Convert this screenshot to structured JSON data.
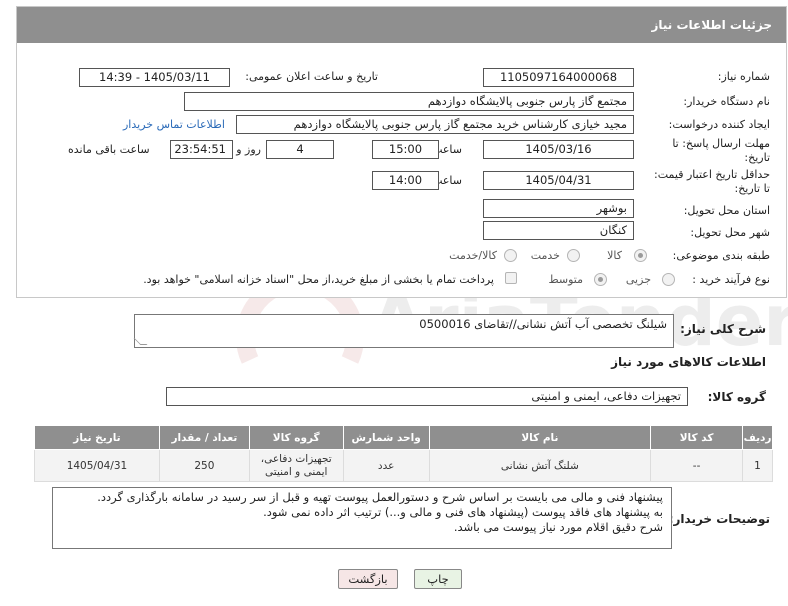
{
  "header": {
    "title": "جزئیات اطلاعات نیاز"
  },
  "fields": {
    "need_number": {
      "label": "شماره نیاز:",
      "value": "1105097164000068"
    },
    "announce_datetime": {
      "label": "تاریخ و ساعت اعلان عمومی:",
      "value": "1405/03/11 - 14:39"
    },
    "buyer_org": {
      "label": "نام دستگاه خریدار:",
      "value": "مجتمع گاز پارس جنوبی  پالایشگاه دوازدهم"
    },
    "requester": {
      "label": "ایجاد کننده درخواست:",
      "value": "مجید خیازی کارشناس خرید مجتمع گاز پارس جنوبی  پالایشگاه دوازدهم",
      "contact_link": "اطلاعات تماس خریدار"
    },
    "reply_deadline": {
      "label_line1": "مهلت ارسال پاسخ: تا",
      "label_line2": "تاریخ:",
      "date": "1405/03/16",
      "time_label": "ساعت",
      "time": "15:00",
      "days": "4",
      "days_label": "روز و",
      "remaining": "23:54:51",
      "remaining_label": "ساعت باقی مانده"
    },
    "price_validity": {
      "label_line1": "حداقل تاریخ اعتبار قیمت:",
      "label_line2": "تا تاریخ:",
      "date": "1405/04/31",
      "time_label": "ساعت",
      "time": "14:00"
    },
    "province": {
      "label": "استان محل تحویل:",
      "value": "بوشهر"
    },
    "city": {
      "label": "شهر محل تحویل:",
      "value": "کنگان"
    },
    "category": {
      "label": "طبقه بندی موضوعی:",
      "options": [
        "کالا",
        "خدمت",
        "کالا/خدمت"
      ],
      "selected": "کالا"
    },
    "process": {
      "label": "نوع فرآیند خرید :",
      "options": [
        "جزیی",
        "متوسط"
      ],
      "selected": "متوسط",
      "payment_note": "پرداخت تمام یا بخشی از مبلغ خرید،از محل \"اسناد خزانه اسلامی\" خواهد بود."
    }
  },
  "description": {
    "label": "شرح کلی نیاز:",
    "value": "شیلنگ تخصصی آب آتش نشانی//تقاضای 0500016"
  },
  "goods": {
    "section_title": "اطلاعات کالاهای مورد نیاز",
    "group_label": "گروه کالا:",
    "group_value": "تجهیزات دفاعی، ایمنی و امنیتی",
    "columns": [
      "ردیف",
      "کد کالا",
      "نام کالا",
      "واحد شمارش",
      "گروه کالا",
      "تعداد / مقدار",
      "تاریخ نیاز"
    ],
    "rows": [
      {
        "row": "1",
        "code": "--",
        "name": "شلنگ آتش نشانی",
        "unit": "عدد",
        "group": "تجهیزات دفاعی، ایمنی و امنیتی",
        "qty": "250",
        "date": "1405/04/31"
      }
    ]
  },
  "buyer_notes": {
    "label": "توضیحات خریدار:",
    "text": "پیشنهاد فنی و مالی می بایست بر اساس شرح و دستورالعمل پیوست تهیه و قبل از سر رسید در سامانه بارگذاری گردد.\nبه پیشنهاد های فاقد پیوست (پیشنهاد های فنی و مالی و...) ترتیب اثر داده نمی شود.\nشرح دقیق اقلام مورد نیاز پیوست می باشد."
  },
  "buttons": {
    "print": "چاپ",
    "back": "بازگشت"
  },
  "watermark": {
    "text": "AriaTender.net"
  },
  "colors": {
    "header_bg": "#8f8f8f",
    "link": "#2a6ab8",
    "print_bg": "#e8f3e4",
    "back_bg": "#f6e6e6"
  }
}
